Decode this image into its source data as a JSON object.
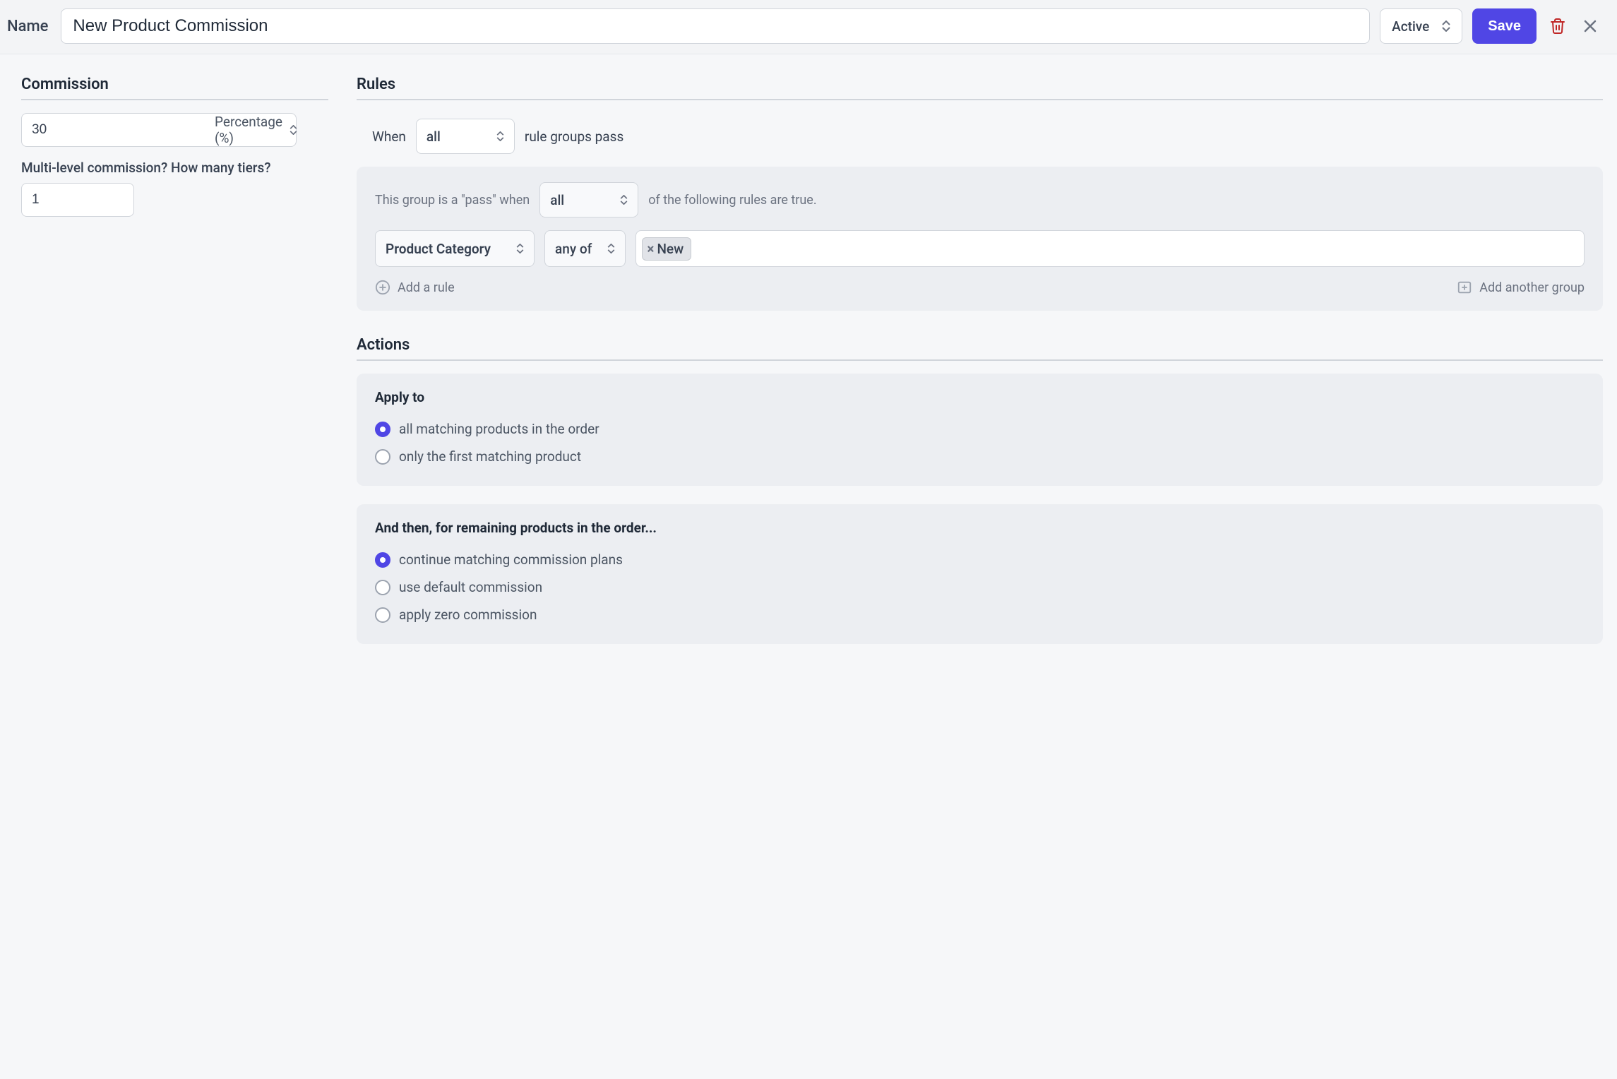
{
  "toolbar": {
    "name_label": "Name",
    "name_value": "New Product Commission",
    "status": "Active",
    "save_label": "Save"
  },
  "commission": {
    "heading": "Commission",
    "value": "30",
    "type_label": "Percentage (%)",
    "tiers_question": "Multi-level commission? How many tiers?",
    "tiers_value": "1"
  },
  "rules": {
    "heading": "Rules",
    "when_prefix": "When",
    "when_mode": "all",
    "when_suffix": "rule groups pass",
    "group": {
      "pass_prefix": "This group is a \"pass\" when",
      "pass_mode": "all",
      "pass_suffix": "of the following rules are true.",
      "rule": {
        "field": "Product Category",
        "operator": "any of",
        "tag": "New"
      },
      "add_rule_label": "Add a rule",
      "add_group_label": "Add another group"
    }
  },
  "actions": {
    "heading": "Actions",
    "apply_title": "Apply to",
    "apply_options": [
      "all matching products in the order",
      "only the first matching product"
    ],
    "apply_selected_index": 0,
    "remaining_title": "And then, for remaining products in the order...",
    "remaining_options": [
      "continue matching commission plans",
      "use default commission",
      "apply zero commission"
    ],
    "remaining_selected_index": 0
  }
}
